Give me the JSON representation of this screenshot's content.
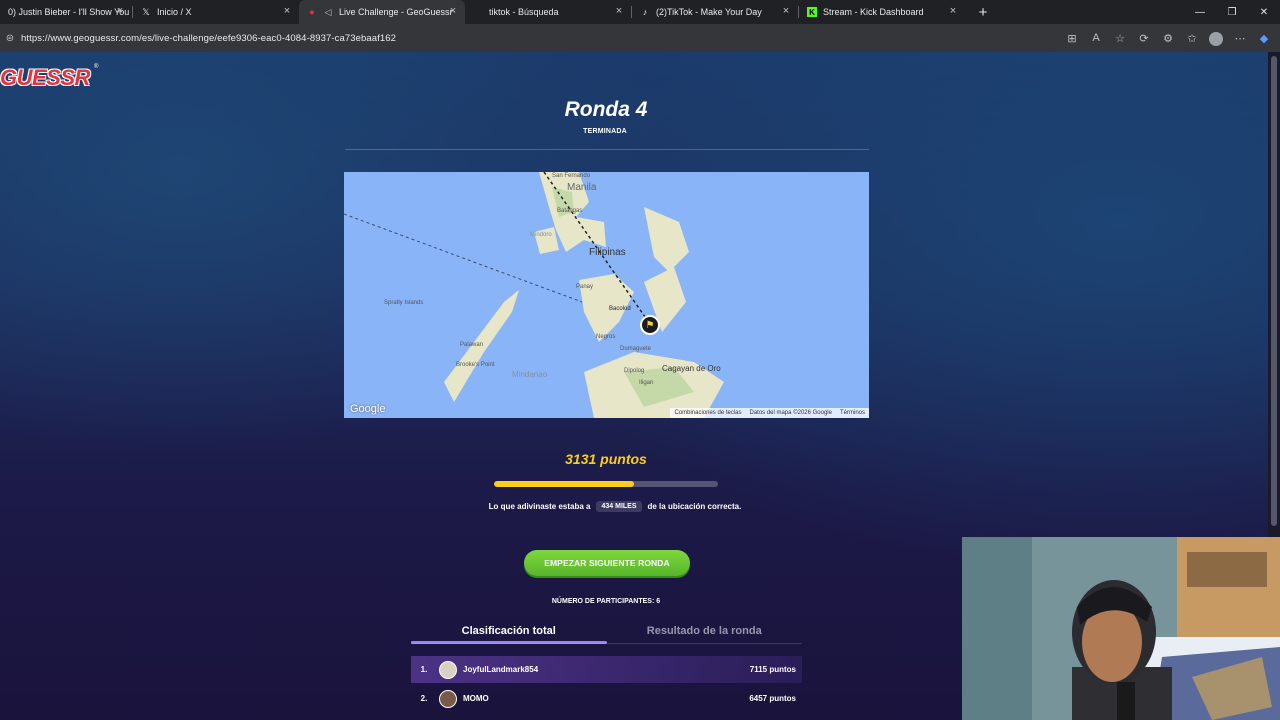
{
  "browser": {
    "tabs": [
      {
        "title": "0) Justin Bieber - I'll Show You",
        "icon": "music-icon",
        "active": false
      },
      {
        "title": "Inicio / X",
        "icon": "x-icon",
        "active": false
      },
      {
        "title": "Live Challenge - GeoGuessr",
        "icon": "geoguessr-pin-icon",
        "active": true
      },
      {
        "title": "tiktok - Búsqueda",
        "icon": "search-icon",
        "active": false
      },
      {
        "title": "(2)TikTok - Make Your Day",
        "icon": "tiktok-icon",
        "active": false
      },
      {
        "title": "Stream - Kick Dashboard",
        "icon": "kick-icon",
        "active": false
      }
    ],
    "url": "https://www.geoguessr.com/es/live-challenge/eefe9306-eac0-4084-8937-ca73ebaaf162"
  },
  "page": {
    "logo": "GUESSR",
    "logo_reg": "®",
    "round_title": "Ronda 4",
    "round_status": "TERMINADA",
    "score_text": "3131 puntos",
    "score_fraction": 0.6262,
    "distance_prefix": "Lo que adivinaste estaba a",
    "distance_value": "434 MILES",
    "distance_suffix": "de la ubicación correcta.",
    "next_button": "EMPEZAR SIGUIENTE RONDA",
    "participants": "NÚMERO DE PARTICIPANTES: 6",
    "tabs": {
      "total": "Clasificación total",
      "round": "Resultado de la ronda"
    },
    "leaderboard": [
      {
        "rank": "1.",
        "name": "JoyfulLandmark854",
        "score": "7115 puntos"
      },
      {
        "rank": "2.",
        "name": "MOMO",
        "score": "6457 puntos"
      }
    ]
  },
  "map": {
    "google": "Google",
    "footer": [
      "Combinaciones de teclas",
      "Datos del mapa ©2026 Google",
      "Términos"
    ],
    "labels": {
      "philippines": "Filipinas",
      "manila": "Manila",
      "bacolod": "Bacolod",
      "cagayan": "Cagayan de Oro",
      "palawan": "Palawan",
      "mindanao": "Mindanao",
      "dumaguete": "Dumaguete",
      "dipolog": "Dipolog",
      "iligan": "Iligan",
      "san_fernando": "San Fernando",
      "batangas": "Batangas",
      "mindoro": "Mindoro",
      "sprat": "Spratly Islands",
      "brookes": "Brooke's Point",
      "negros": "Negros",
      "panay": "Panay"
    }
  },
  "colors": {
    "score": "#fecd19",
    "button": "#6bc734",
    "accent_tab": "#9a82f2",
    "logo": "#e8323c"
  }
}
